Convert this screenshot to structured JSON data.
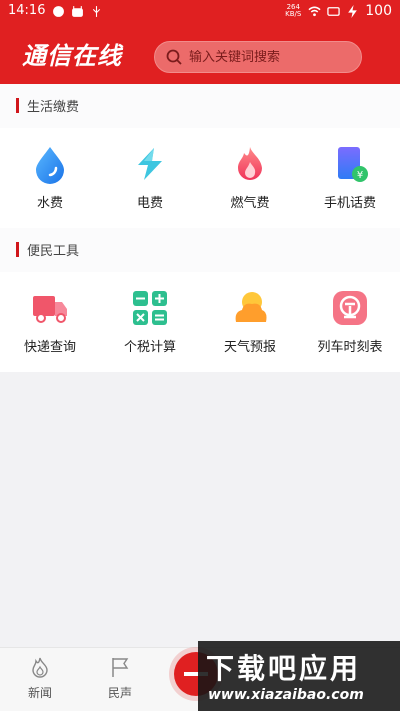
{
  "status": {
    "time": "14:16",
    "net_speed_value": "264",
    "net_speed_unit": "KB/S",
    "battery": "100"
  },
  "header": {
    "logo_text": "通信在线",
    "search_placeholder": "输入关键词搜索"
  },
  "sections": [
    {
      "title": "生活缴费",
      "items": [
        {
          "label": "水费",
          "icon": "water-drop-icon"
        },
        {
          "label": "电费",
          "icon": "lightning-icon"
        },
        {
          "label": "燃气费",
          "icon": "flame-icon"
        },
        {
          "label": "手机话费",
          "icon": "phone-bill-icon"
        }
      ]
    },
    {
      "title": "便民工具",
      "items": [
        {
          "label": "快递查询",
          "icon": "delivery-truck-icon"
        },
        {
          "label": "个税计算",
          "icon": "calculator-icon"
        },
        {
          "label": "天气预报",
          "icon": "weather-icon"
        },
        {
          "label": "列车时刻表",
          "icon": "train-icon"
        }
      ]
    }
  ],
  "bottom_nav": [
    {
      "label": "新闻",
      "icon": "flame-outline-icon"
    },
    {
      "label": "民声",
      "icon": "flag-icon"
    }
  ],
  "watermark": {
    "title": "下载吧应用",
    "url": "www.xiazaibao.com"
  },
  "colors": {
    "brand_red": "#e02021",
    "page_bg": "#f2f2f4"
  }
}
